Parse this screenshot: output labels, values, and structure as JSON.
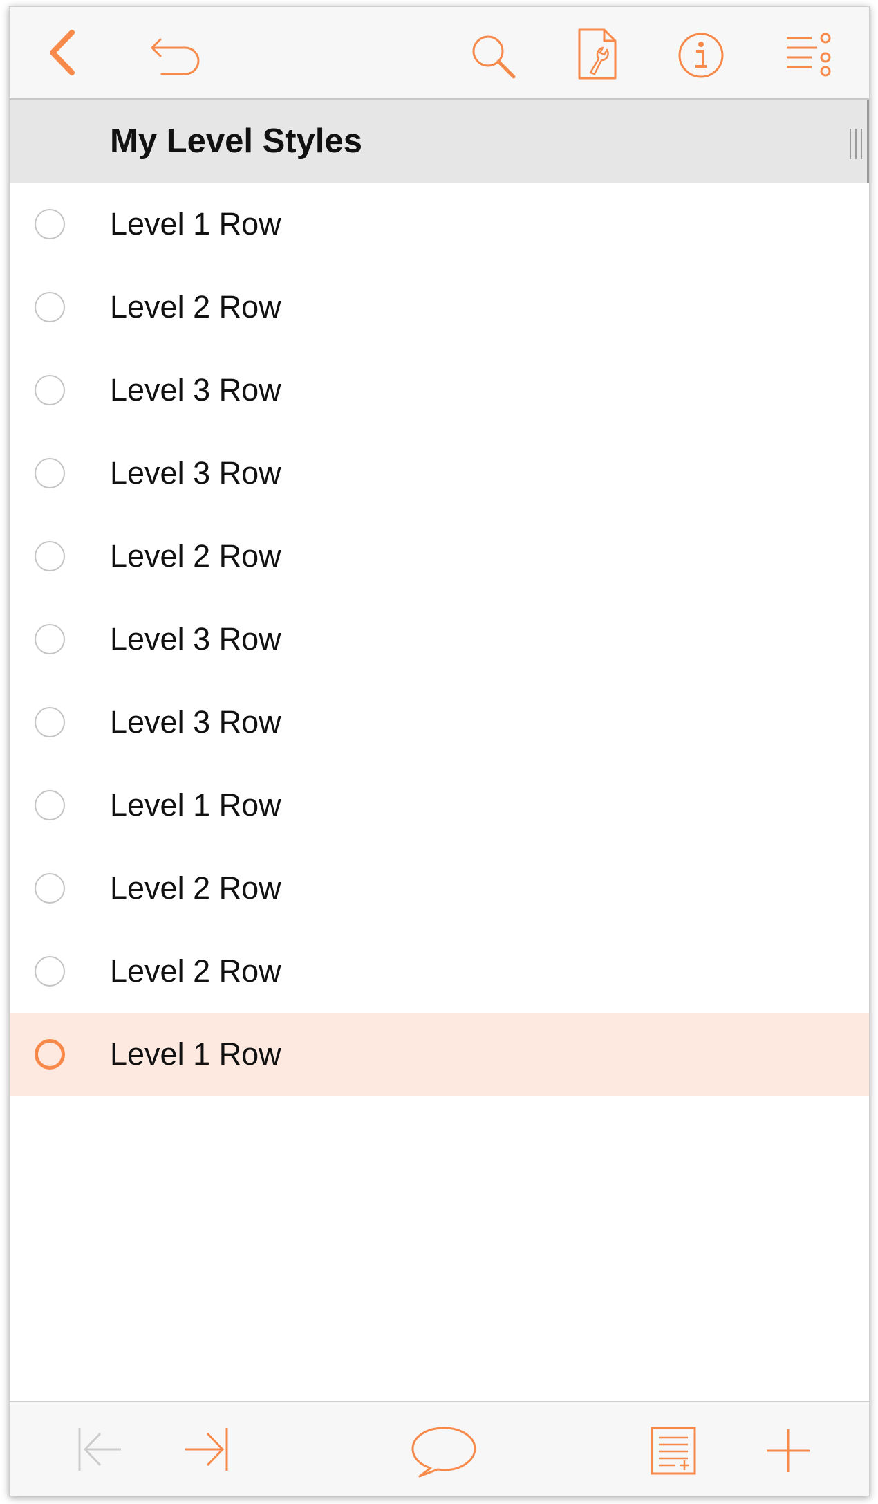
{
  "colors": {
    "accent": "#f7894a",
    "selected_row_bg": "#fee9e0",
    "header_bg": "#e6e6e6",
    "bullet_gray": "#c4c4c4",
    "disabled_icon": "#cccccc"
  },
  "toolbar": {
    "icons": [
      "back-chevron-icon",
      "undo-icon",
      "search-icon",
      "document-settings-icon",
      "info-icon",
      "outline-menu-icon"
    ]
  },
  "header": {
    "title": "My Level Styles"
  },
  "rows": [
    {
      "label": "Level 1 Row",
      "selected": false
    },
    {
      "label": "Level 2 Row",
      "selected": false
    },
    {
      "label": "Level 3 Row",
      "selected": false
    },
    {
      "label": "Level 3 Row",
      "selected": false
    },
    {
      "label": "Level 2 Row",
      "selected": false
    },
    {
      "label": "Level 3 Row",
      "selected": false
    },
    {
      "label": "Level 3 Row",
      "selected": false
    },
    {
      "label": "Level 1 Row",
      "selected": false
    },
    {
      "label": "Level 2 Row",
      "selected": false
    },
    {
      "label": "Level 2 Row",
      "selected": false
    },
    {
      "label": "Level 1 Row",
      "selected": true
    }
  ],
  "bottombar": {
    "icons": [
      "outdent-icon",
      "indent-icon",
      "note-bubble-icon",
      "add-note-list-icon",
      "add-row-icon"
    ],
    "outdent_enabled": false
  }
}
